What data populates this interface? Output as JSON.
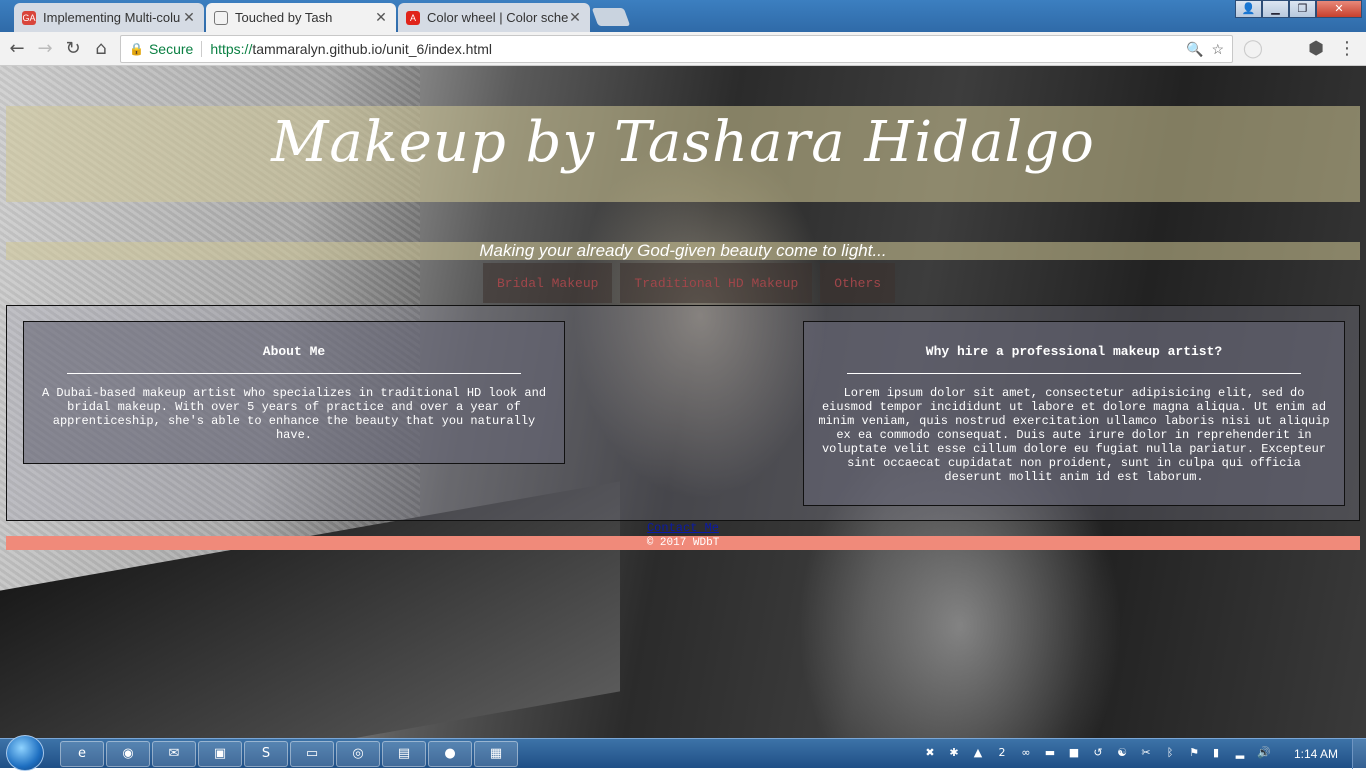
{
  "browser": {
    "tabs": [
      {
        "title": "Implementing Multi-colu",
        "favicon": "ga-icon",
        "color": "#d9453b",
        "active": false
      },
      {
        "title": "Touched by Tash",
        "favicon": "page-icon",
        "color": "#777777",
        "active": true
      },
      {
        "title": "Color wheel | Color sche",
        "favicon": "adobe-icon",
        "color": "#e0241a",
        "active": false
      }
    ],
    "secure_label": "Secure",
    "url_scheme": "https://",
    "url_rest": "tammaralyn.github.io/unit_6/index.html"
  },
  "site": {
    "title": "Makeup by Tashara Hidalgo",
    "tagline": "Making your already God-given beauty come to light...",
    "nav": [
      "Bridal Makeup",
      "Traditional HD Makeup",
      "Others"
    ],
    "about": {
      "heading": "About Me",
      "body": "A Dubai-based makeup artist who specializes in traditional HD look and bridal makeup. With over 5 years of practice and over a year of apprenticeship, she's able to enhance the beauty that you naturally have."
    },
    "why": {
      "heading": "Why hire a professional makeup artist?",
      "body": "Lorem ipsum dolor sit amet, consectetur adipisicing elit, sed do eiusmod tempor incididunt ut labore et dolore magna aliqua. Ut enim ad minim veniam, quis nostrud exercitation ullamco laboris nisi ut aliquip ex ea commodo consequat. Duis aute irure dolor in reprehenderit in voluptate velit esse cillum dolore eu fugiat nulla pariatur. Excepteur sint occaecat cupidatat non proident, sunt in culpa qui officia deserunt mollit anim id est laborum."
    },
    "contact_link": "Contact Me",
    "copyright": "© 2017 WDbT",
    "accent_color": "#f08a7a"
  },
  "taskbar": {
    "clock": "1:14 AM",
    "tray_badge": "2"
  }
}
